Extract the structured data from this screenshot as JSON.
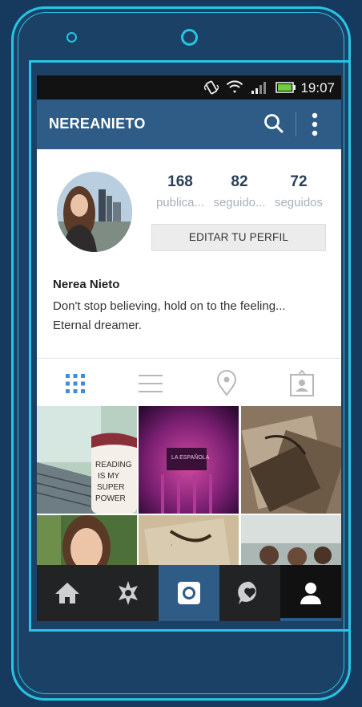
{
  "status_bar": {
    "time": "19:07"
  },
  "app_bar": {
    "username": "NEREANIETO"
  },
  "profile": {
    "stats": [
      {
        "value": "168",
        "label": "publica..."
      },
      {
        "value": "82",
        "label": "seguido..."
      },
      {
        "value": "72",
        "label": "seguidos"
      }
    ],
    "edit_button": "EDITAR TU PERFIL",
    "full_name": "Nerea Nieto",
    "bio_line1": "Don't stop believing, hold on to the feeling...",
    "bio_line2": "Eternal dreamer."
  },
  "tabs": [
    "grid-icon",
    "list-icon",
    "location-pin-icon",
    "tagged-photos-icon"
  ],
  "photos": {
    "mug_text": "READING IS MY SUPER POWER",
    "neon_text": "LA ESPAÑOLA"
  },
  "bottom_nav": [
    "home-icon",
    "explore-icon",
    "camera-icon",
    "activity-icon",
    "profile-icon"
  ],
  "colors": {
    "accent": "#2e5c87",
    "frame": "#27c4e6",
    "background": "#163a5e"
  }
}
